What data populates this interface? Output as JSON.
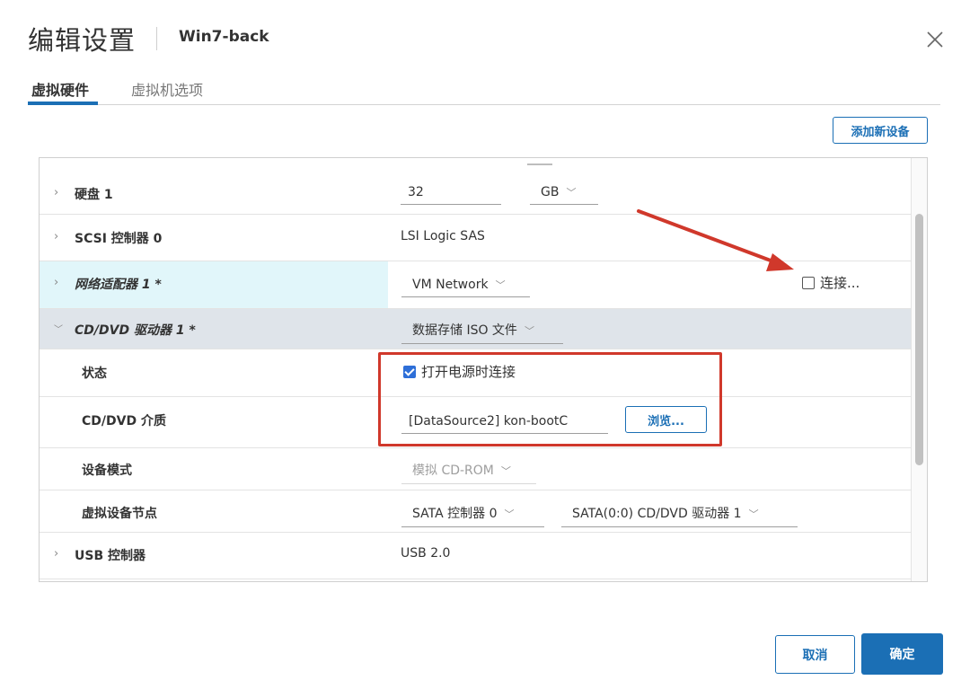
{
  "dialog": {
    "title": "编辑设置",
    "vm_name": "Win7-back",
    "close_glyph": "✕"
  },
  "tabs": [
    {
      "label": "虚拟硬件",
      "active": true
    },
    {
      "label": "虚拟机选项",
      "active": false
    }
  ],
  "toolbar": {
    "add_device_label": "添加新设备"
  },
  "hardware": {
    "disk": {
      "chevron": "›",
      "label": "硬盘 1",
      "size_value": "32",
      "unit": "GB",
      "unit_arrow": "﹀"
    },
    "scsi": {
      "chevron": "›",
      "label": "SCSI 控制器 0",
      "value": "LSI Logic SAS"
    },
    "network": {
      "chevron": "›",
      "label": "网络适配器 1 *",
      "network_value": "VM Network",
      "arrow": "﹀",
      "connect_label": "连接...",
      "connect_checked": false
    },
    "cddvd": {
      "chevron": "﹀",
      "label": "CD/DVD 驱动器 1 *",
      "type_value": "数据存储 ISO 文件",
      "arrow": "﹀",
      "status_label": "状态",
      "status_checkbox_label": "打开电源时连接",
      "status_checked": true,
      "media_label": "CD/DVD 介质",
      "media_value": "[DataSource2] kon-bootC",
      "browse_label": "浏览...",
      "device_mode_label": "设备模式",
      "device_mode_value": "模拟 CD-ROM",
      "node_label": "虚拟设备节点",
      "controller_value": "SATA 控制器 0",
      "node_value": "SATA(0:0) CD/DVD 驱动器 1"
    },
    "usb": {
      "chevron": "›",
      "label": "USB 控制器",
      "value": "USB 2.0"
    }
  },
  "footer": {
    "cancel_label": "取消",
    "ok_label": "确定"
  },
  "colors": {
    "accent": "#1b6fb5",
    "annotation_red": "#d0382b",
    "network_row_bg": "#e1f6fa",
    "cddvd_row_bg": "#dfe4ea",
    "checkbox_blue": "#2e6fd8"
  }
}
